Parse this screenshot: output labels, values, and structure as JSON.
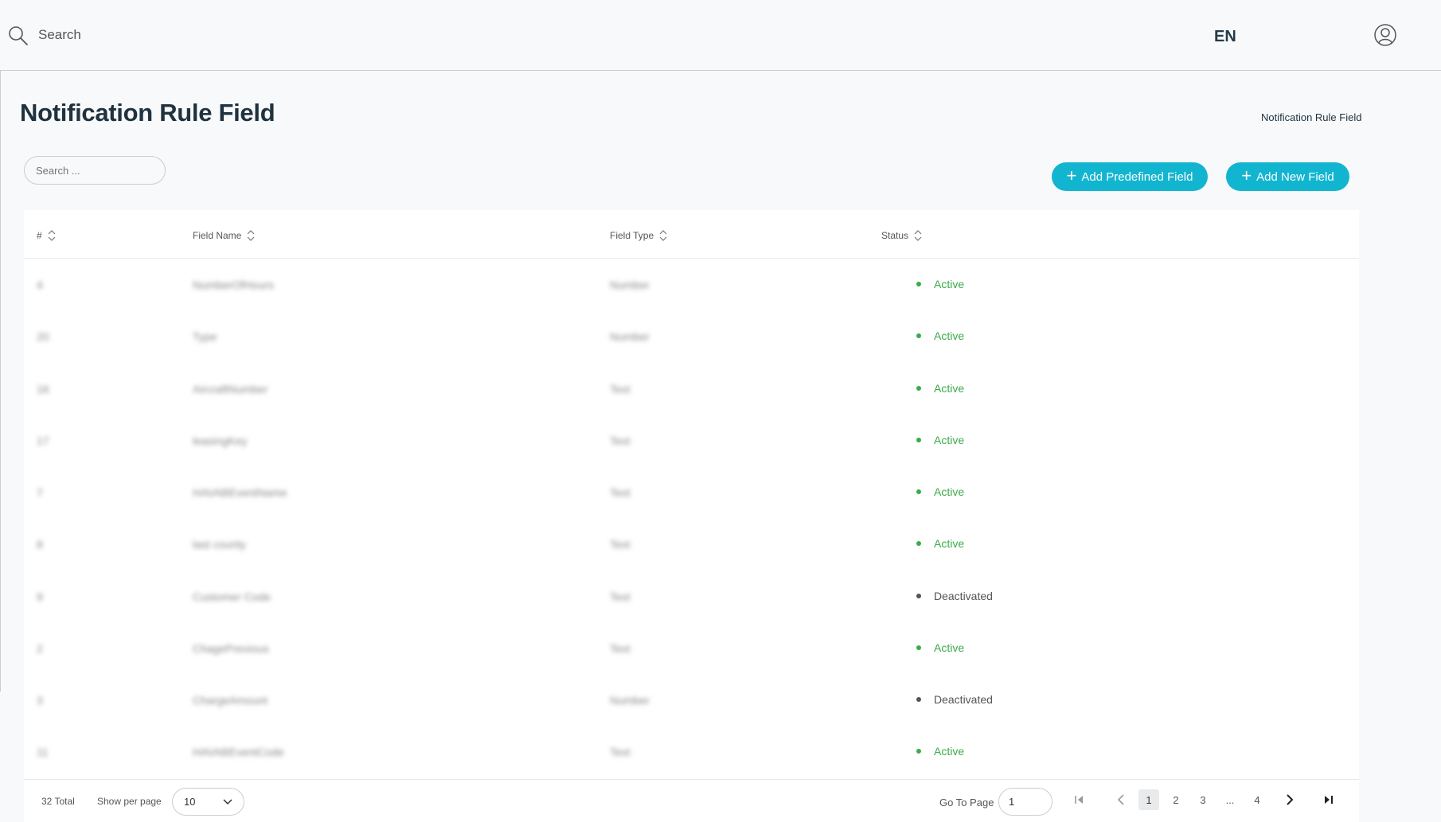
{
  "topbar": {
    "search_label": "Search",
    "language": "EN"
  },
  "page": {
    "title": "Notification Rule Field",
    "breadcrumb": "Notification Rule Field"
  },
  "filter": {
    "search_placeholder": "Search ..."
  },
  "actions": {
    "add_predefined": "Add Predefined Field",
    "add_new": "Add New Field"
  },
  "table": {
    "columns": [
      "#",
      "Field Name",
      "Field Type",
      "Status"
    ],
    "rows": [
      {
        "id": "4",
        "field_name": "NumberOfHours",
        "field_type": "Number",
        "status": "Active"
      },
      {
        "id": "20",
        "field_name": "Type",
        "field_type": "Number",
        "status": "Active"
      },
      {
        "id": "16",
        "field_name": "AircraftNumber",
        "field_type": "Text",
        "status": "Active"
      },
      {
        "id": "17",
        "field_name": "leasingKey",
        "field_type": "Text",
        "status": "Active"
      },
      {
        "id": "7",
        "field_name": "HAVABEventName",
        "field_type": "Text",
        "status": "Active"
      },
      {
        "id": "8",
        "field_name": "last county",
        "field_type": "Text",
        "status": "Active"
      },
      {
        "id": "9",
        "field_name": "Customer Code",
        "field_type": "Text",
        "status": "Deactivated"
      },
      {
        "id": "2",
        "field_name": "ChagePrevious",
        "field_type": "Text",
        "status": "Active"
      },
      {
        "id": "3",
        "field_name": "ChargeAmount",
        "field_type": "Number",
        "status": "Deactivated"
      },
      {
        "id": "11",
        "field_name": "HAVABEventCode",
        "field_type": "Text",
        "status": "Active"
      }
    ]
  },
  "footer": {
    "total": "32 Total",
    "show_per_page": "Show per page",
    "per_page_value": "10",
    "go_to_page": "Go To Page",
    "go_to_value": "1",
    "pages": [
      "1",
      "2",
      "3",
      "...",
      "4"
    ],
    "current_page": "1"
  },
  "colors": {
    "accent": "#12b5d0",
    "active": "#3bab4a",
    "title": "#1f3240"
  }
}
